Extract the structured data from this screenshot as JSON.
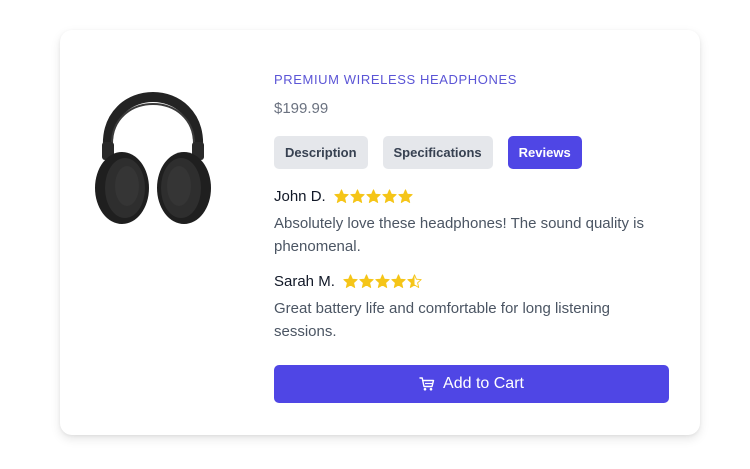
{
  "product": {
    "title": "PREMIUM WIRELESS HEADPHONES",
    "price": "$199.99",
    "image_icon": "headphones"
  },
  "tabs": [
    {
      "label": "Description",
      "active": false
    },
    {
      "label": "Specifications",
      "active": false
    },
    {
      "label": "Reviews",
      "active": true
    }
  ],
  "reviews": [
    {
      "name": "John D.",
      "rating": 5,
      "text": "Absolutely love these headphones! The sound quality is phenomenal."
    },
    {
      "name": "Sarah M.",
      "rating": 4.5,
      "text": "Great battery life and comfortable for long listening sessions."
    }
  ],
  "cart_button": {
    "label": "Add to Cart",
    "icon": "cart"
  },
  "colors": {
    "accent": "#4f46e5",
    "title": "#5b55d6",
    "star": "#f5c518",
    "tab_inactive_bg": "#e5e7eb"
  }
}
